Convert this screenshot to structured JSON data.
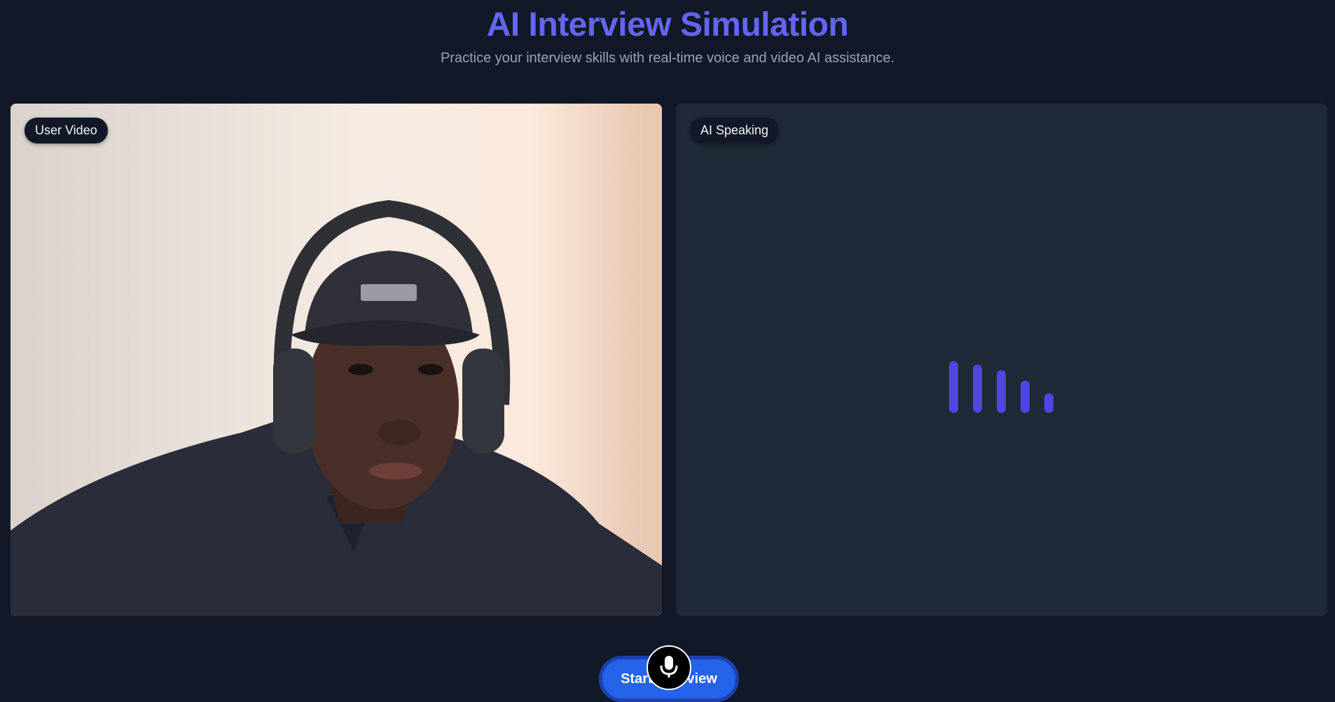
{
  "header": {
    "title": "AI Interview Simulation",
    "subtitle": "Practice your interview skills with real-time voice and video AI assistance."
  },
  "user_panel": {
    "badge": "User Video",
    "image_description": "webcam-feed"
  },
  "ai_panel": {
    "badge": "AI Speaking",
    "audio_levels": [
      1.0,
      0.93,
      0.83,
      0.62,
      0.38
    ]
  },
  "controls": {
    "start_label": "Start Interview",
    "mic_icon": "microphone-icon"
  },
  "colors": {
    "accent": "#6366f1",
    "bar": "#4f46e5",
    "button": "#2563eb",
    "background": "#111827",
    "panel": "#1f2937"
  }
}
